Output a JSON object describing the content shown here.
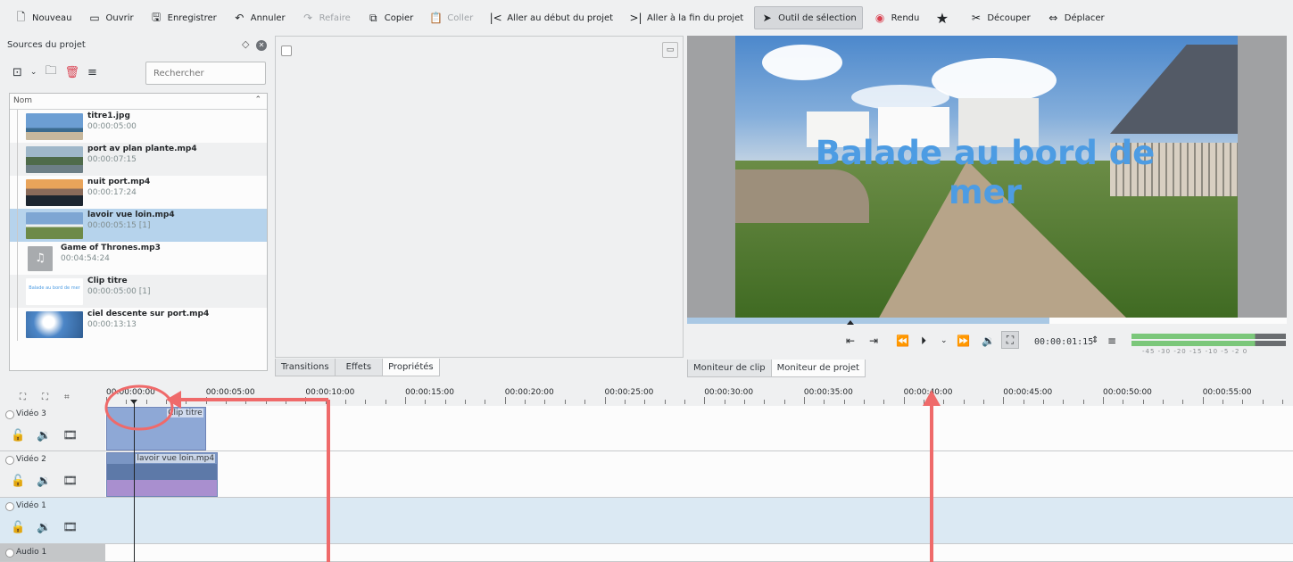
{
  "toolbar": {
    "items": [
      {
        "label": "Nouveau",
        "icon": "new-file-icon"
      },
      {
        "label": "Ouvrir",
        "icon": "open-folder-icon"
      },
      {
        "label": "Enregistrer",
        "icon": "save-icon"
      },
      {
        "label": "Annuler",
        "icon": "undo-icon"
      },
      {
        "label": "Refaire",
        "icon": "redo-icon",
        "disabled": true
      },
      {
        "label": "Copier",
        "icon": "copy-icon"
      },
      {
        "label": "Coller",
        "icon": "paste-icon",
        "disabled": true
      },
      {
        "label": "Aller au début du projet",
        "icon": "go-start-icon"
      },
      {
        "label": "Aller à la fin du projet",
        "icon": "go-end-icon"
      },
      {
        "label": "Outil de sélection",
        "icon": "cursor-icon",
        "active": true
      },
      {
        "label": "Rendu",
        "icon": "render-icon"
      },
      {
        "label": "",
        "icon": "star-icon"
      },
      {
        "label": "Découper",
        "icon": "scissors-icon"
      },
      {
        "label": "Déplacer",
        "icon": "move-icon"
      }
    ]
  },
  "bin": {
    "title": "Sources du projet",
    "search_placeholder": "Rechercher",
    "column_header": "Nom",
    "clips": [
      {
        "name": "titre1.jpg",
        "duration": "00:00:05:00",
        "thumb": "landscape"
      },
      {
        "name": "port av plan plante.mp4",
        "duration": "00:00:07:15",
        "thumb": "harbor"
      },
      {
        "name": "nuit port.mp4",
        "duration": "00:00:17:24",
        "thumb": "sunset"
      },
      {
        "name": "lavoir vue loin.mp4",
        "duration": "00:00:05:15  [1]",
        "thumb": "path",
        "selected": true
      },
      {
        "name": "Game of Thrones.mp3",
        "duration": "00:04:54:24",
        "thumb": "audio"
      },
      {
        "name": "Clip titre",
        "duration": "00:00:05:00  [1]",
        "thumb": "title",
        "thumb_text": "Balade au bord de mer"
      },
      {
        "name": "ciel descente sur port.mp4",
        "duration": "00:00:13:13",
        "thumb": "sky"
      }
    ]
  },
  "props_tabs": [
    "Transitions",
    "Effets",
    "Propriétés"
  ],
  "props_active_tab": 2,
  "monitor": {
    "overlay_title": "Balade au bord de mer",
    "timecode": "00:00:01:15",
    "vu_scale": "-45  -30  -20 -15  -10    -5   -2  0",
    "tabs": [
      "Moniteur de clip",
      "Moniteur de projet"
    ],
    "active_tab": 1,
    "progress": 0.604
  },
  "timeline": {
    "ruler_labels": [
      "00:00:00:00",
      "00:00:05:00",
      "00:00:10:00",
      "00:00:15:00",
      "00:00:20:00",
      "00:00:25:00",
      "00:00:30:00",
      "00:00:35:00",
      "00:00:40:00",
      "00:00:45:00",
      "00:00:50:00",
      "00:00:55:00"
    ],
    "tracks": [
      {
        "name": "Vidéo 3",
        "kind": "video"
      },
      {
        "name": "Vidéo 2",
        "kind": "video"
      },
      {
        "name": "Vidéo 1",
        "kind": "video",
        "active": true
      },
      {
        "name": "Audio 1",
        "kind": "audio"
      }
    ],
    "clips": [
      {
        "track": 0,
        "label": "Clip titre",
        "start": "00:00:00:00",
        "end": "00:00:05:00"
      },
      {
        "track": 1,
        "label": "lavoir vue loin.mp4",
        "start": "00:00:00:00",
        "end": "00:00:05:15"
      }
    ]
  },
  "colors": {
    "accent": "#ef6a6a",
    "selection": "#b6d3ec",
    "title_text": "#4d9ce3"
  }
}
